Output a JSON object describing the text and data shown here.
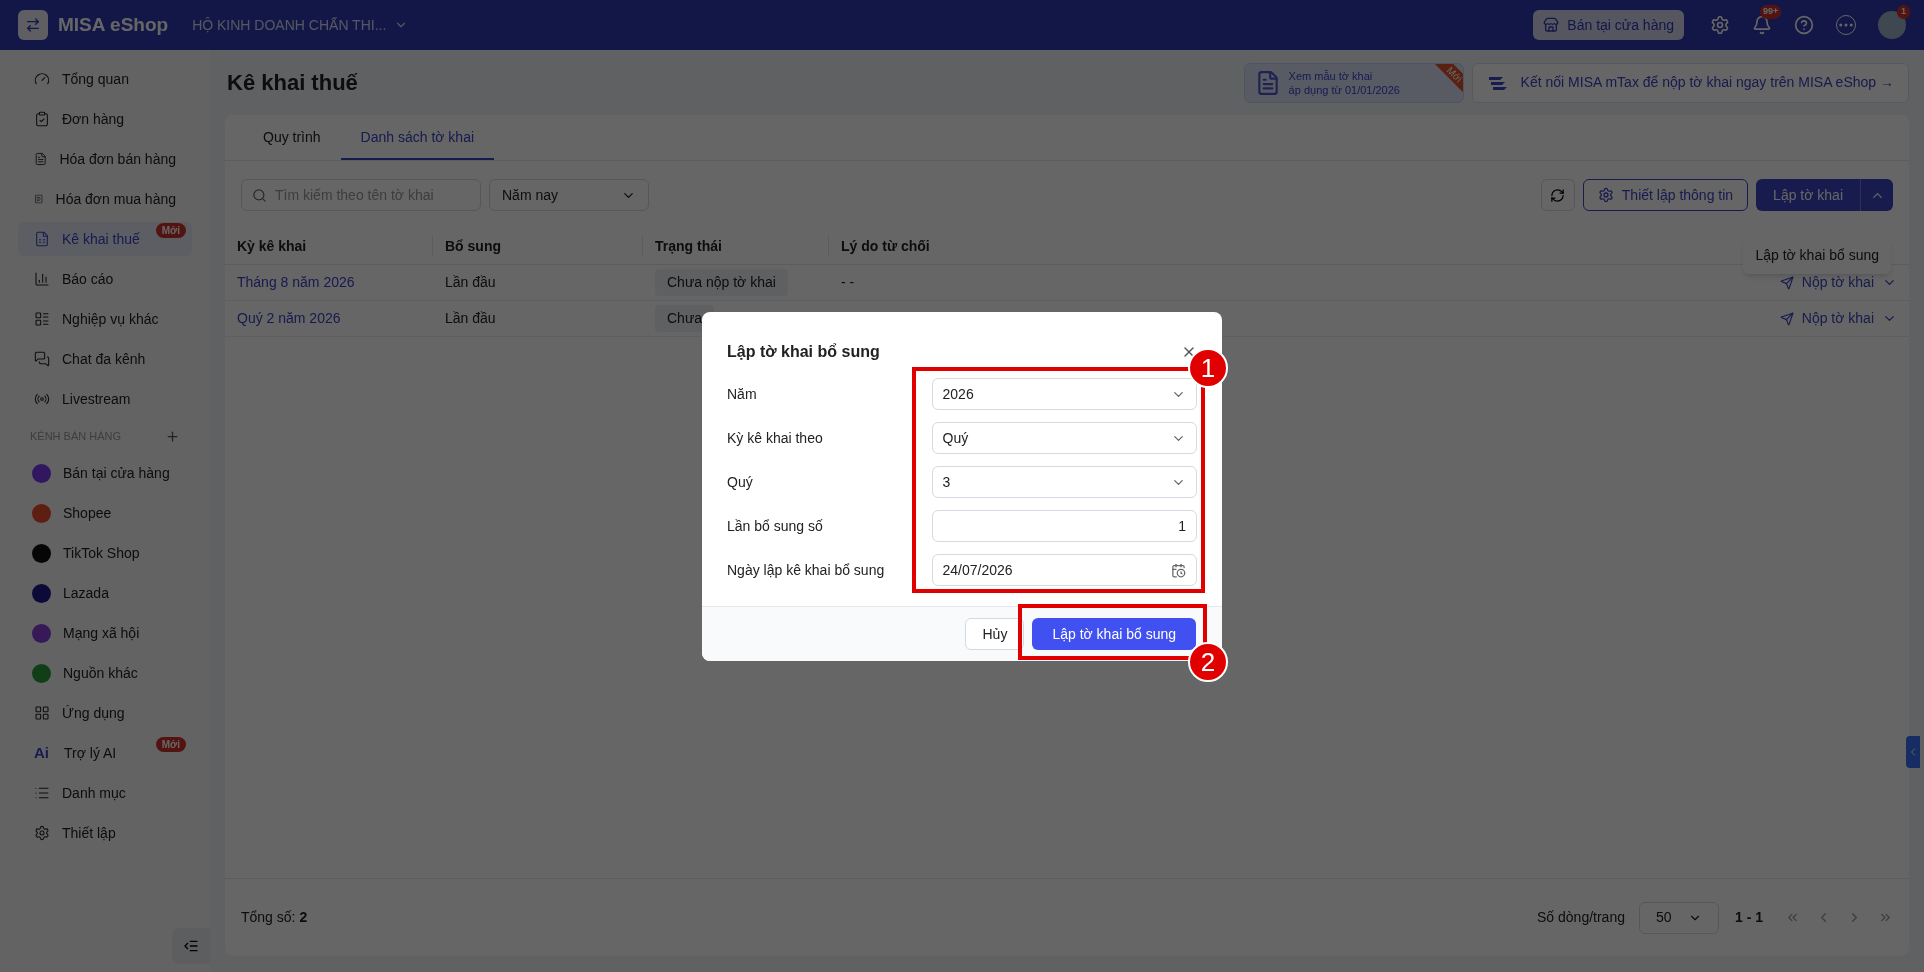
{
  "topbar": {
    "logo_text": "MISA eShop",
    "store_name": "HỘ KINH DOANH CHẤN THI...",
    "store_button": "Bán tại cửa hàng",
    "notification_badge": "99+",
    "avatar_badge": "1"
  },
  "sidebar": {
    "items": [
      {
        "label": "Tổng quan",
        "selected": false
      },
      {
        "label": "Đơn hàng",
        "selected": false
      },
      {
        "label": "Hóa đơn bán hàng",
        "selected": false
      },
      {
        "label": "Hóa đơn mua hàng",
        "selected": false
      },
      {
        "label": "Kê khai thuế",
        "selected": true,
        "badge": "Mới"
      },
      {
        "label": "Báo cáo",
        "selected": false
      },
      {
        "label": "Nghiệp vụ khác",
        "selected": false
      },
      {
        "label": "Chat đa kênh",
        "selected": false
      },
      {
        "label": "Livestream",
        "selected": false
      }
    ],
    "channel_section": {
      "title": "KÊNH BÁN HÀNG",
      "items": [
        {
          "label": "Bán tại cửa hàng"
        },
        {
          "label": "Shopee"
        },
        {
          "label": "TikTok Shop"
        },
        {
          "label": "Lazada"
        },
        {
          "label": "Mạng xã hội"
        },
        {
          "label": "Nguồn khác"
        }
      ]
    },
    "more_items": [
      {
        "label": "Ứng dụng",
        "selected": false
      },
      {
        "label": "Trợ lý AI",
        "selected": false,
        "icon_text": "Ai",
        "badge": "Mới"
      },
      {
        "label": "Danh mục",
        "selected": false
      },
      {
        "label": "Thiết lập",
        "selected": false
      }
    ]
  },
  "page_title": "Kê khai thuế",
  "promo_banner": {
    "line1": "Xem mẫu tờ khai",
    "line2": "áp dụng từ 01/01/2026",
    "ribbon": "Mới"
  },
  "connect_banner": "Kết nối MISA mTax để nộp tờ khai ngay trên MISA eShop →",
  "tabs": [
    {
      "label": "Quy trình",
      "selected": false
    },
    {
      "label": "Danh sách tờ khai",
      "selected": true
    }
  ],
  "toolbar": {
    "search_placeholder": "Tìm kiếm theo tên tờ khai",
    "period_filter": "Năm nay",
    "settings_button": "Thiết lập thông tin",
    "create_button": "Lập tờ khai",
    "dropdown_item": "Lập tờ khai bổ sung"
  },
  "table": {
    "columns": [
      "Kỳ kê khai",
      "Bổ sung",
      "Trạng thái",
      "Lý do từ chối"
    ],
    "rows": [
      {
        "period": "Tháng 8 năm 2026",
        "supplement": "Lần đầu",
        "status": "Chưa nộp tờ khai",
        "reject_reason": "- -",
        "action": "Nộp tờ khai"
      },
      {
        "period": "Quý 2 năm 2026",
        "supplement": "Lần đầu",
        "status": "Chưa",
        "action": "Nộp tờ khai"
      }
    ]
  },
  "footer": {
    "total": "Tổng số: **2**",
    "rows_per_page_label": "Số dòng/trang",
    "page_size": "50",
    "range": "1 - 1"
  },
  "dialog": {
    "title": "Lập tờ khai bổ sung",
    "fields": [
      {
        "label": "Năm",
        "kind": "select",
        "value": "2026"
      },
      {
        "label": "Kỳ kê khai theo",
        "kind": "select",
        "value": "Quý"
      },
      {
        "label": "Quý",
        "kind": "select",
        "value": "3"
      },
      {
        "label": "Lần bổ sung số",
        "kind": "number",
        "value": "1"
      },
      {
        "label": "Ngày lập kê khai bổ sung",
        "kind": "date",
        "value": "24/07/2026"
      }
    ],
    "cancel_button": "Hủy",
    "submit_button": "Lập tờ khai bổ sung"
  },
  "callouts": [
    "1",
    "2"
  ]
}
